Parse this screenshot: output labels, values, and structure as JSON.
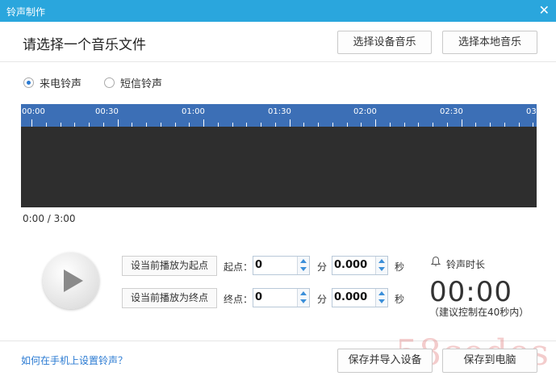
{
  "window": {
    "title": "铃声制作",
    "close_glyph": "✕"
  },
  "header": {
    "title": "请选择一个音乐文件",
    "device_music_button": "选择设备音乐",
    "local_music_button": "选择本地音乐"
  },
  "ringtone_type": {
    "options": [
      {
        "label": "来电铃声",
        "selected": true
      },
      {
        "label": "短信铃声",
        "selected": false
      }
    ]
  },
  "timeline": {
    "ticks": [
      "00:00",
      "00:30",
      "01:00",
      "01:30",
      "02:00",
      "02:30",
      "03"
    ]
  },
  "playback": {
    "time_readout": "0:00 / 3:00"
  },
  "controls": {
    "set_start_button": "设当前播放为起点",
    "set_end_button": "设当前播放为终点",
    "start_label": "起点：",
    "end_label": "终点：",
    "start_min": "0",
    "start_sec": "0.000",
    "end_min": "0",
    "end_sec": "0.000",
    "min_unit": "分",
    "sec_unit": "秒"
  },
  "duration": {
    "label": "铃声时长",
    "value": "00:00",
    "hint": "（建议控制在40秒内）"
  },
  "footer": {
    "help_link": "如何在手机上设置铃声？",
    "save_import_button": "保存并导入设备",
    "save_pc_button": "保存到电脑"
  },
  "watermark": "58codes"
}
